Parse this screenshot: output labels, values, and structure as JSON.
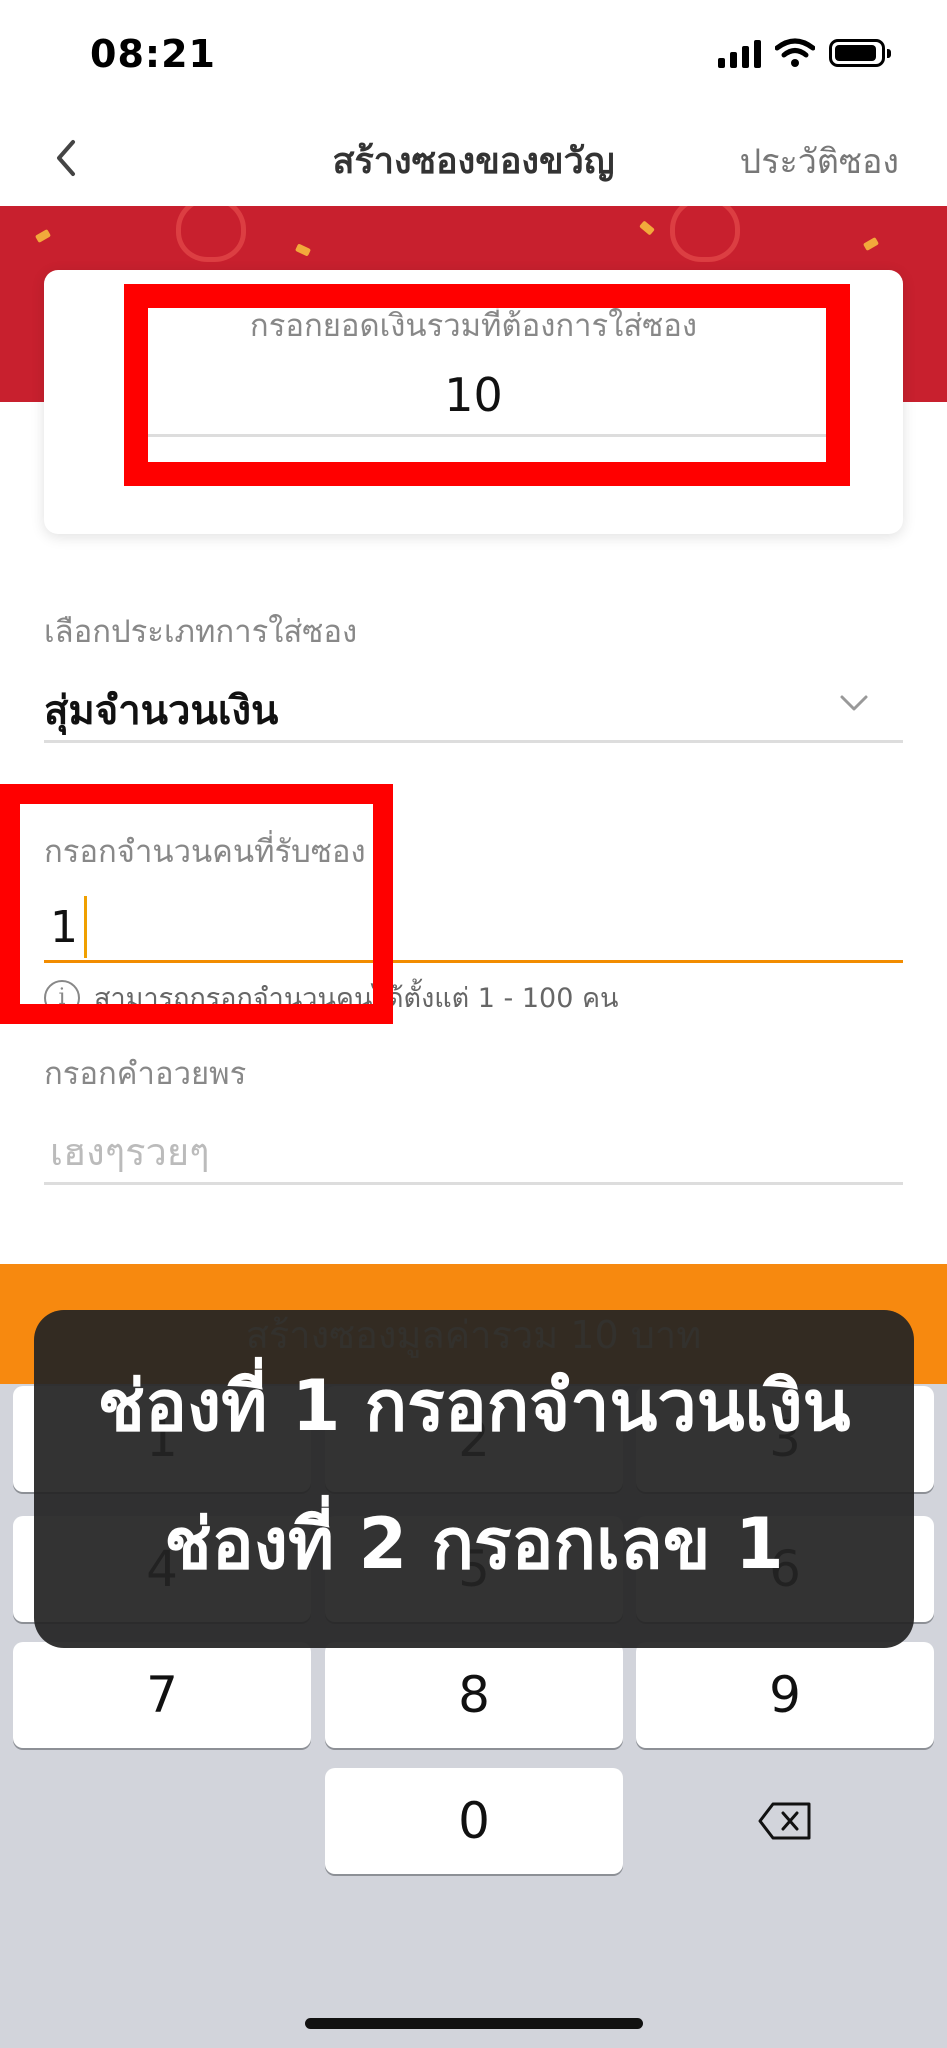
{
  "status_bar": {
    "time": "08:21"
  },
  "header": {
    "title": "สร้างซองของขวัญ",
    "history_label": "ประวัติซอง"
  },
  "amount_card": {
    "label": "กรอกยอดเงินรวมที่ต้องการใส่ซอง",
    "value": "10"
  },
  "envelope_type": {
    "label": "เลือกประเภทการใส่ซอง",
    "selected": "สุ่มจำนวนเงิน"
  },
  "recipients": {
    "label": "กรอกจำนวนคนที่รับซอง",
    "value": "1",
    "hint": "สามารถกรอกจำนวนคนได้ตั้งแต่ 1 - 100 คน"
  },
  "wish": {
    "label": "กรอกคำอวยพร",
    "placeholder": "เฮงๆรวยๆ"
  },
  "create_button": {
    "label": "สร้างซองมูลค่ารวม 10 บาท"
  },
  "keypad": {
    "keys": [
      "1",
      "2",
      "3",
      "4",
      "5",
      "6",
      "7",
      "8",
      "9",
      "0"
    ]
  },
  "overlay": {
    "line1": "ช่องที่ 1 กรอกจำนวนเงิน",
    "line2": "ช่องที่ 2 กรอกเลข 1"
  },
  "colors": {
    "accent": "#f7890f",
    "banner": "#c8202e",
    "highlight": "#ff0000"
  }
}
